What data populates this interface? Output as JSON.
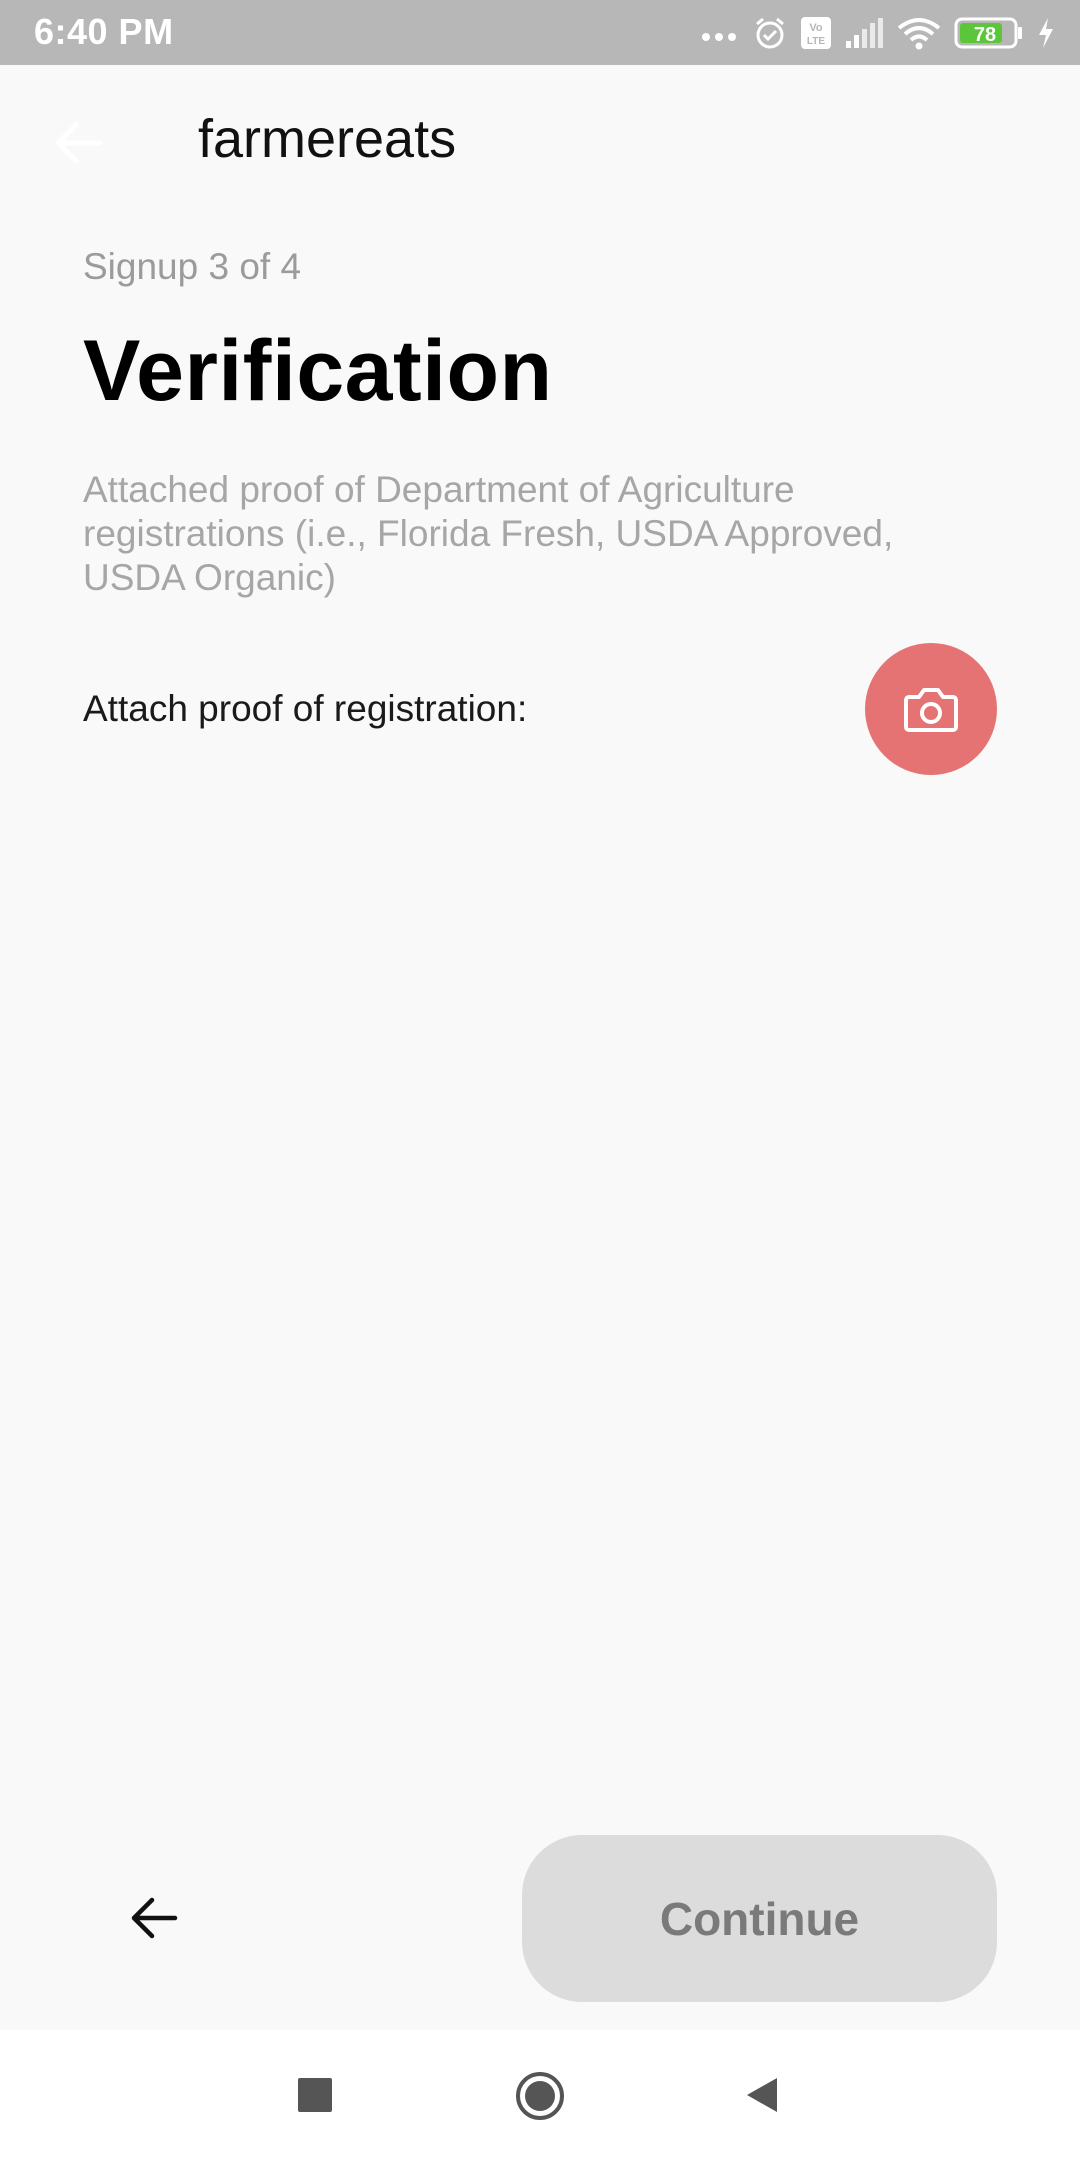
{
  "status_bar": {
    "time": "6:40 PM",
    "battery_level": "78",
    "icons": [
      "more-dots-icon",
      "alarm-icon",
      "volte-icon",
      "signal-icon",
      "wifi-icon",
      "battery-icon",
      "charging-icon"
    ],
    "volte_text": "Vo LTE"
  },
  "app_bar": {
    "title": "farmereats",
    "back_icon": "arrow-left-icon"
  },
  "content": {
    "step": "Signup 3 of 4",
    "title": "Verification",
    "description": "Attached proof of Department of Agriculture registrations (i.e., Florida Fresh, USDA Approved, USDA Organic)",
    "attach_label": "Attach proof of registration:",
    "camera_icon": "camera-icon"
  },
  "footer": {
    "back_icon": "arrow-left-icon",
    "continue_label": "Continue"
  },
  "colors": {
    "accent": "#e57373",
    "disabled_button": "#dcdcdc",
    "status_bar": "#b7b7b7",
    "background": "#f9f9f9"
  },
  "nav_bar": {
    "buttons": [
      "recents-square-icon",
      "home-circle-icon",
      "back-triangle-icon"
    ]
  }
}
